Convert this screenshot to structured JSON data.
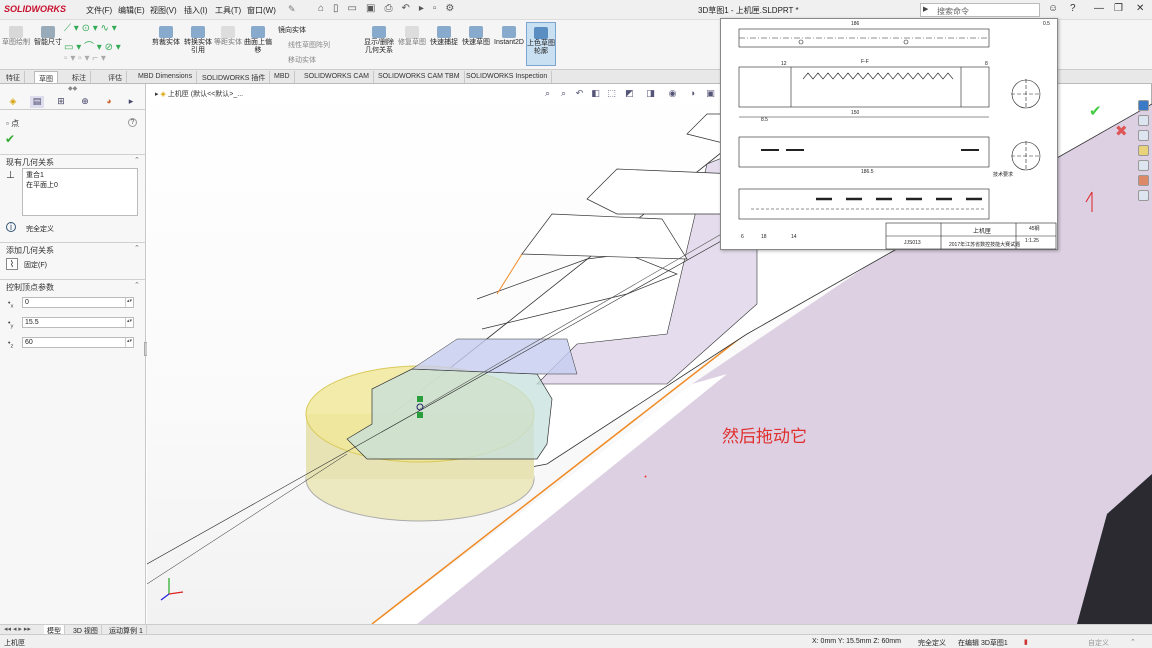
{
  "app": {
    "logo": "SOLIDWORKS",
    "menus": [
      "文件(F)",
      "编辑(E)",
      "视图(V)",
      "插入(I)",
      "工具(T)",
      "窗口(W)"
    ],
    "title": "3D草图1 - 上机匣.SLDPRT *",
    "search_placeholder": "搜索命令",
    "window_controls": [
      "?",
      "—",
      "❐",
      "✕"
    ]
  },
  "command_manager": {
    "groups": [
      {
        "label": "草图绘制",
        "active": false
      },
      {
        "label": "智能尺寸",
        "active": true
      },
      {
        "label": "剪裁实体",
        "active": true
      },
      {
        "label": "转换实体引用",
        "active": true
      },
      {
        "label": "等距实体",
        "active": false
      },
      {
        "label": "曲面上偏移",
        "active": true
      },
      {
        "label": "显示/删除几何关系",
        "active": true
      },
      {
        "label": "修复草图",
        "active": false
      },
      {
        "label": "快速捕捉",
        "active": true
      },
      {
        "label": "快速草图",
        "active": true
      },
      {
        "label": "Instant2D",
        "active": true
      },
      {
        "label": "上色草图轮廓",
        "active": true
      }
    ],
    "mirror_items": [
      "镜向实体",
      "线性草图阵列",
      "移动实体"
    ]
  },
  "tabs": [
    "特征",
    "草图",
    "标注",
    "评估",
    "MBD Dimensions",
    "SOLIDWORKS 插件",
    "MBD",
    "SOLIDWORKS CAM",
    "SOLIDWORKS CAM TBM",
    "SOLIDWORKS Inspection"
  ],
  "active_tab": "草图",
  "property_manager": {
    "title": "点",
    "existing_relations_header": "现有几何关系",
    "relations": [
      "重合1",
      "在平面上0"
    ],
    "status": "完全定义",
    "add_relations_header": "添加几何关系",
    "fix_label": "固定(F)",
    "params_header": "控制顶点参数",
    "params": [
      {
        "axis": "x",
        "value": "0"
      },
      {
        "axis": "y",
        "value": "15.5"
      },
      {
        "axis": "z",
        "value": "60"
      }
    ]
  },
  "viewport": {
    "tree_path": "上机匣 (默认<<默认>_...",
    "annotation": "然后拖动它"
  },
  "drawing": {
    "title_block": {
      "part_name": "上机匣",
      "material": "45钢",
      "scale": "1:1.25",
      "drawing_no": "JJS013",
      "school": "2017年江苏省数控技能大赛试题"
    },
    "dims": [
      "186",
      "0.5",
      "150",
      "186.5",
      "12",
      "8",
      "6",
      "18",
      "14",
      "8.5"
    ],
    "section_label": "F-F",
    "notes": "技术要求"
  },
  "bottom_tabs": [
    "模型",
    "3D 视图",
    "运动算例 1"
  ],
  "status_bar": {
    "left": "上机匣",
    "coords": "X: 0mm Y: 15.5mm Z: 60mm",
    "state": "完全定义",
    "editing": "在编辑 3D草图1",
    "custom": "自定义"
  },
  "colors": {
    "accent_red": "#c8102e",
    "annotation_red": "#e0302e",
    "highlight_orange": "#f08a24",
    "selection_yellow": "#f0e89a",
    "face_purple": "#dcd0e2"
  }
}
